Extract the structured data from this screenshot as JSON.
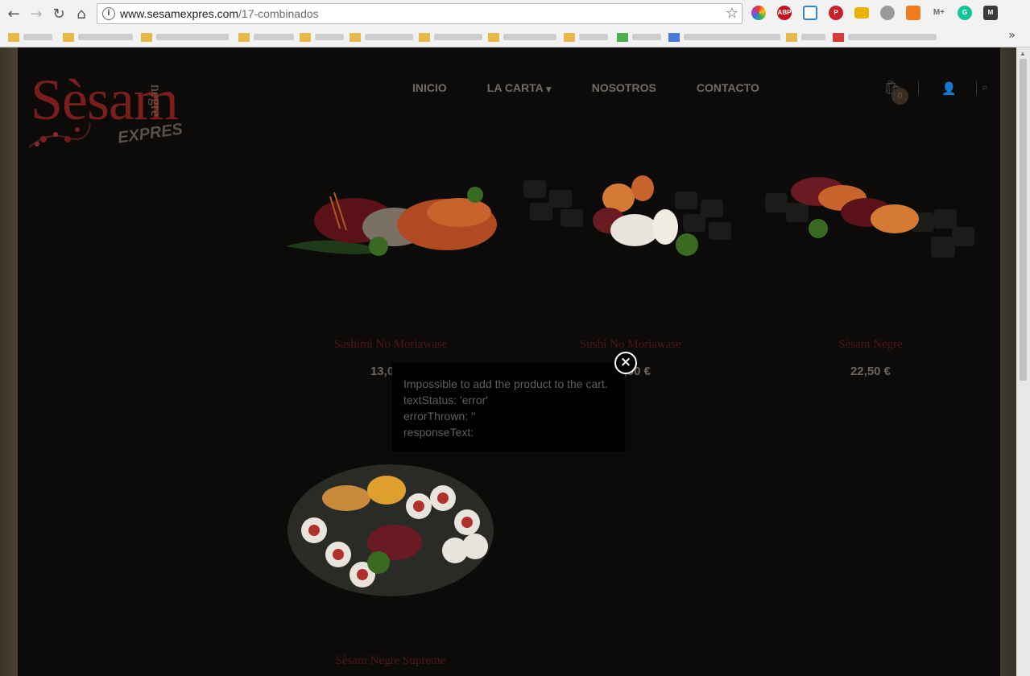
{
  "browser": {
    "url_host": "www.sesamexpres.com",
    "url_path": "/17-combinados",
    "extensions": [
      {
        "name": "color-wheel-ext",
        "color": "#e0408a"
      },
      {
        "name": "adblock-plus-ext",
        "label": "ABP",
        "color": "#c4121a"
      },
      {
        "name": "translate-ext",
        "color": "#3a7de0"
      },
      {
        "name": "pinterest-ext",
        "label": "P",
        "color": "#cb2027"
      },
      {
        "name": "meter-ext",
        "color": "#e8b400"
      },
      {
        "name": "palette-ext",
        "color": "#9a9a9a"
      },
      {
        "name": "chart-ext",
        "color": "#f07a1e"
      },
      {
        "name": "movistar-ext",
        "label": "M+",
        "color": "#6b6b6b"
      },
      {
        "name": "grammarly-ext",
        "label": "G",
        "color": "#15c39a"
      },
      {
        "name": "m-ext",
        "label": "M",
        "color": "#3a3a3a"
      }
    ]
  },
  "site": {
    "logo": {
      "main": "Sèsam",
      "sub": "negre",
      "tag": "EXPRES"
    },
    "nav": [
      {
        "label": "INICIO"
      },
      {
        "label": "LA CARTA"
      },
      {
        "label": "NOSOTROS"
      },
      {
        "label": "CONTACTO"
      }
    ],
    "cart_count": "0"
  },
  "products": [
    {
      "name": "Sashimi No Moriawase",
      "price": "13,00 €"
    },
    {
      "name": "Sushi No Moriawase",
      "price": "13,00 €"
    },
    {
      "name": "Sèsam Negre",
      "price": "22,50 €"
    },
    {
      "name": "Sèsam Negre Supreme",
      "price": ""
    }
  ],
  "popup": {
    "lines": [
      "Impossible to add the product to the cart.",
      "textStatus: 'error'",
      "errorThrown: ''",
      "responseText:"
    ],
    "close_label": "×"
  }
}
